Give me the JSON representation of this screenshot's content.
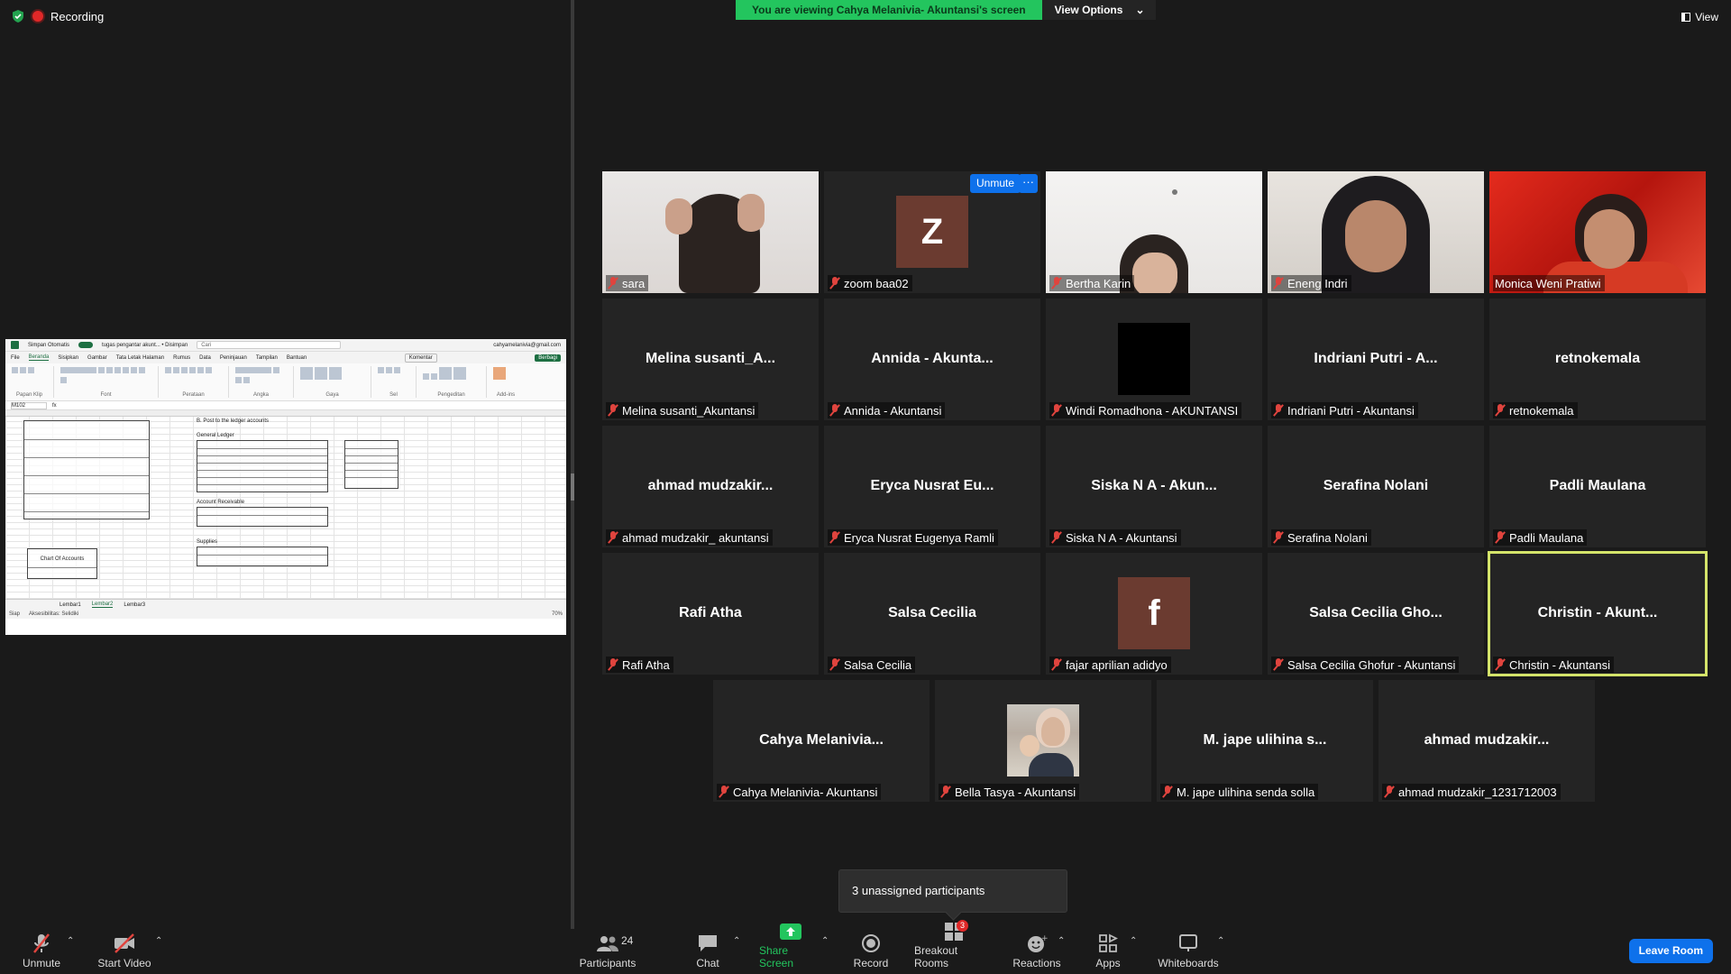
{
  "recording": {
    "label": "Recording"
  },
  "banner": {
    "text": "You are viewing Cahya Melanivia- Akuntansi's screen",
    "view_options": "View Options"
  },
  "view_btn": {
    "label": "View"
  },
  "zoom_overlay": {
    "unmute": "Unmute",
    "more": "···"
  },
  "excel": {
    "title_doc": "tugas pengantar akunt... • Disimpan",
    "autosave": "Simpan Otomatis",
    "search": "Cari",
    "account": "cahyamelanivia@gmail.com",
    "tabs": [
      "File",
      "Beranda",
      "Sisipkan",
      "Gambar",
      "Tata Letak Halaman",
      "Rumus",
      "Data",
      "Peninjauan",
      "Tampilan",
      "Bantuan"
    ],
    "comment": "Komentar",
    "share": "Berbagi",
    "groups": [
      "Papan Klip",
      "Font",
      "Perataan",
      "Angka",
      "Gaya",
      "Sel",
      "Pengeditan",
      "Add-ins"
    ],
    "name_box": "M102",
    "section_title": "B. Post to the ledger accounts",
    "tables": [
      "General Ledger",
      "Account Receivable",
      "Supplies",
      "Chart Of Accounts"
    ],
    "sheets": [
      "Lembar1",
      "Lembar2",
      "Lembar3"
    ],
    "status_ready": "Siap",
    "accessibility": "Aksesibilitas: Selidiki",
    "zoom": "70%"
  },
  "participants": [
    {
      "name": "sara",
      "type": "video",
      "style": "sara"
    },
    {
      "name": "zoom baa02",
      "type": "letter",
      "letter": "Z"
    },
    {
      "name": "Bertha Karin",
      "type": "video",
      "style": "bertha"
    },
    {
      "name": "Eneng Indri",
      "type": "video",
      "style": "eneng"
    },
    {
      "name": "Monica Weni Pratiwi",
      "type": "video",
      "style": "monica",
      "muted": false
    },
    {
      "name": "Melina susanti_Akuntansi",
      "display": "Melina  susanti_A...",
      "type": "name"
    },
    {
      "name": "Annida - Akuntansi",
      "display": "Annida  - Akunta...",
      "type": "name"
    },
    {
      "name": "Windi Romadhona - AKUNTANSI",
      "type": "black"
    },
    {
      "name": "Indriani Putri - Akuntansi",
      "display": "Indriani Putri - A...",
      "type": "name"
    },
    {
      "name": "retnokemala",
      "display": "retnokemala",
      "type": "name"
    },
    {
      "name": "ahmad mudzakir_ akuntansi",
      "display": "ahmad  mudzakir...",
      "type": "name"
    },
    {
      "name": "Eryca Nusrat Eugenya Ramli",
      "display": "Eryca Nusrat Eu...",
      "type": "name"
    },
    {
      "name": "Siska N A - Akuntansi",
      "display": "Siska N A - Akun...",
      "type": "name"
    },
    {
      "name": "Serafina Nolani",
      "display": "Serafina Nolani",
      "type": "name"
    },
    {
      "name": "Padli Maulana",
      "display": "Padli Maulana",
      "type": "name"
    },
    {
      "name": "Rafi Atha",
      "display": "Rafi Atha",
      "type": "name"
    },
    {
      "name": "Salsa Cecilia",
      "display": "Salsa Cecilia",
      "type": "name"
    },
    {
      "name": "fajar aprilian adidyo",
      "type": "letter",
      "letter": "f"
    },
    {
      "name": "Salsa Cecilia Ghofur - Akuntansi",
      "display": "Salsa Cecilia Gho...",
      "type": "name"
    },
    {
      "name": "Christin  - Akuntansi",
      "display": "Christin  - Akunt...",
      "type": "name",
      "active": true
    },
    {
      "name": "Cahya Melanivia- Akuntansi",
      "display": "Cahya  Melanivia...",
      "type": "name"
    },
    {
      "name": "Bella Tasya - Akuntansi",
      "type": "photo"
    },
    {
      "name": "M. jape ulihina senda solla",
      "display": "M. jape ulihina s...",
      "type": "name"
    },
    {
      "name": "ahmad mudzakir_1231712003",
      "display": "ahmad  mudzakir...",
      "type": "name"
    }
  ],
  "unassigned": {
    "text": "3 unassigned participants"
  },
  "toolbar": {
    "unmute": "Unmute",
    "start_video": "Start Video",
    "participants": "Participants",
    "participants_count": "24",
    "chat": "Chat",
    "share_screen": "Share Screen",
    "record": "Record",
    "breakout_rooms": "Breakout Rooms",
    "breakout_badge": "3",
    "reactions": "Reactions",
    "apps": "Apps",
    "whiteboards": "Whiteboards",
    "leave_room": "Leave Room"
  },
  "colors": {
    "accent_blue": "#0e71eb",
    "banner_green": "#23c55e",
    "active_speaker": "#d4e46a",
    "muted_red": "#e0443e"
  }
}
